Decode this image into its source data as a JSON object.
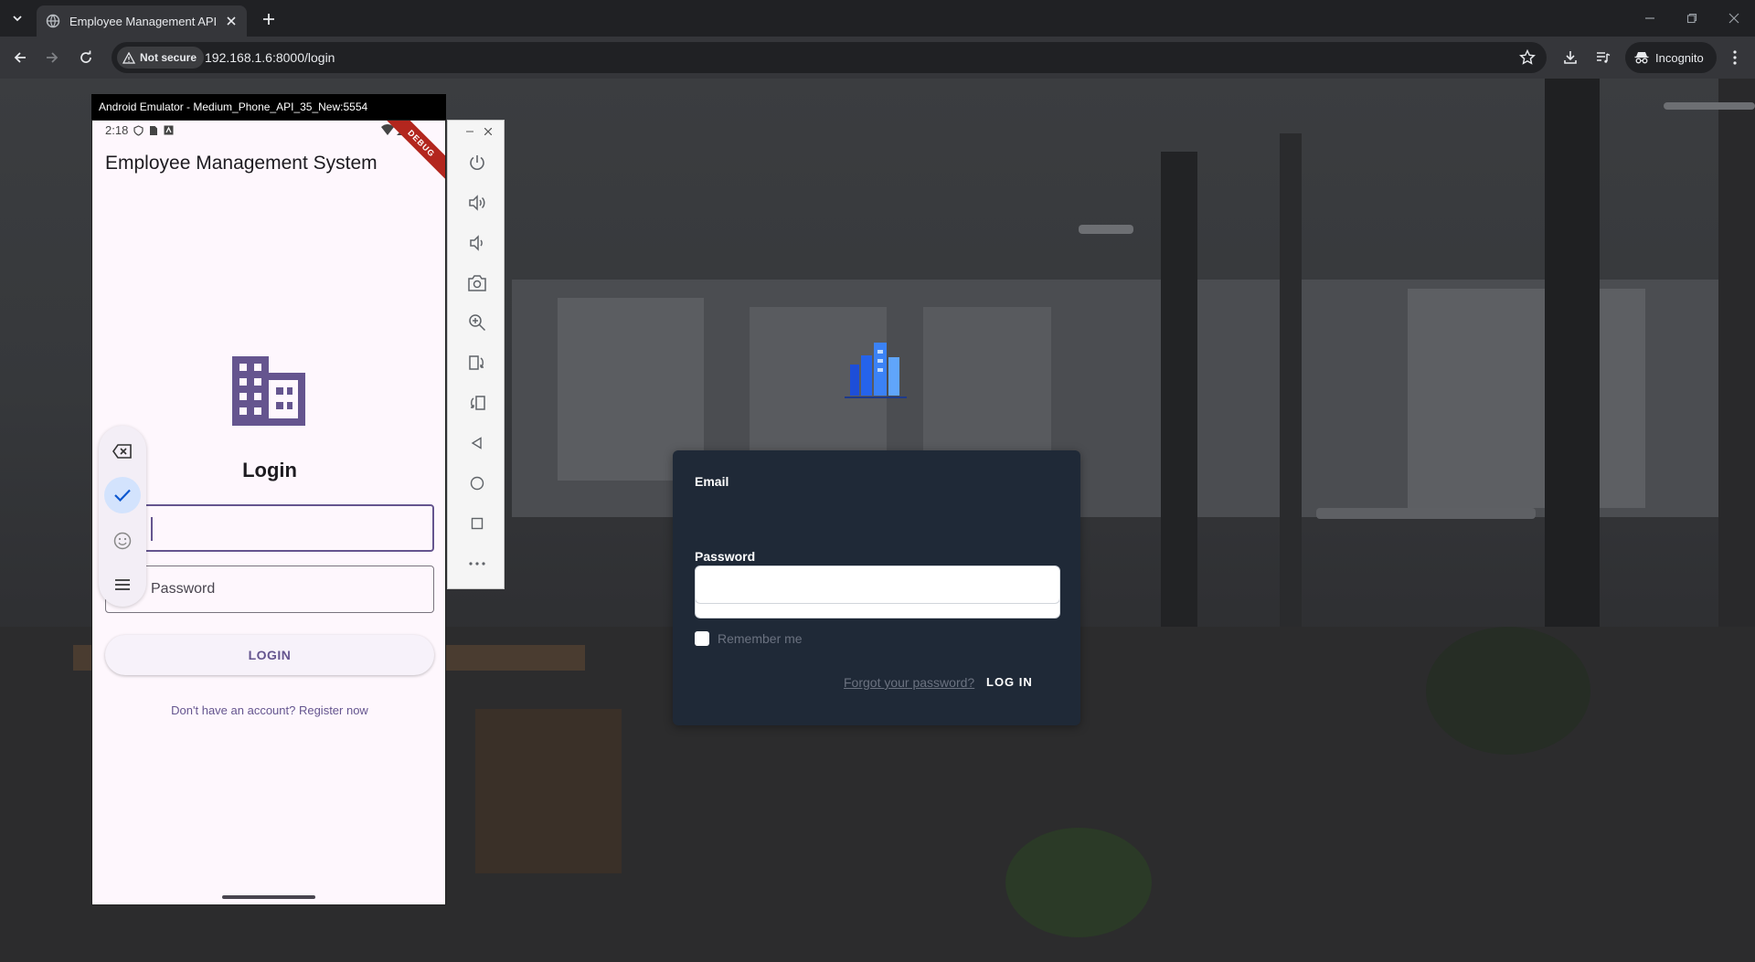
{
  "browser": {
    "tab_title": "Employee Management API",
    "security_label": "Not secure",
    "url": "192.168.1.6:8000/login",
    "profile_label": "Incognito"
  },
  "emulator": {
    "window_title": "Android Emulator - Medium_Phone_API_35_New:5554",
    "status_time": "2:18",
    "debug_banner": "DEBUG",
    "sidebar_icons": [
      "power-icon",
      "volume-up-icon",
      "volume-down-icon",
      "camera-icon",
      "zoom-icon",
      "rotate-left-icon",
      "rotate-right-icon",
      "back-icon",
      "home-icon",
      "overview-icon",
      "more-icon"
    ]
  },
  "app": {
    "appbar_title": "Employee Management System",
    "heading": "Login",
    "password_label": "Password",
    "login_button": "LOGIN",
    "register_link": "Don't have an account? Register now",
    "accent_color": "#65558f"
  },
  "web_login": {
    "email_label": "Email",
    "password_label": "Password",
    "remember_label": "Remember me",
    "forgot_link": "Forgot your password?",
    "login_button": "LOG IN",
    "card_color": "#1f2937"
  }
}
